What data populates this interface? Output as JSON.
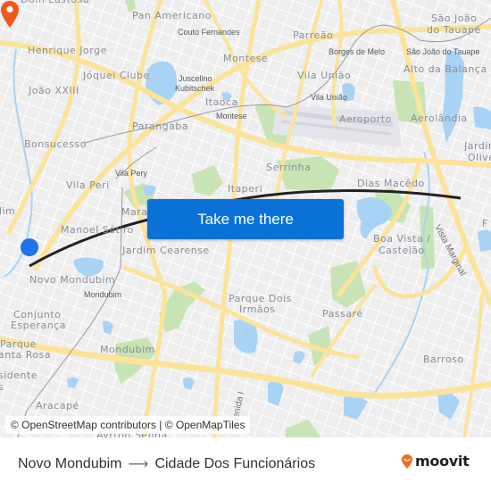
{
  "map": {
    "neighborhoods": [
      {
        "name": "Dom Lustosa"
      },
      {
        "name": "Pan Americano"
      },
      {
        "name": "Henrique Jorge"
      },
      {
        "name": "Jóquei Clube"
      },
      {
        "name": "João XXIII"
      },
      {
        "name": "Montese"
      },
      {
        "name": "Parreão"
      },
      {
        "name": "Vila União"
      },
      {
        "name": "São João do Tauape"
      },
      {
        "name": "Alto da Balança"
      },
      {
        "name": "Aeroporto"
      },
      {
        "name": "Aerolândia"
      },
      {
        "name": "Itaoca"
      },
      {
        "name": "Parangaba"
      },
      {
        "name": "Bonsucesso"
      },
      {
        "name": "Serrinha"
      },
      {
        "name": "Jardim Oliveiras"
      },
      {
        "name": "Vila Peri"
      },
      {
        "name": "Itaperi"
      },
      {
        "name": "Dias Macêdo"
      },
      {
        "name": "Maraponga"
      },
      {
        "name": "Manoel Sátiro"
      },
      {
        "name": "Jardim Cearense"
      },
      {
        "name": "Boa Vista / Castelão"
      },
      {
        "name": "Novo Mondubim"
      },
      {
        "name": "Conjunto Esperança"
      },
      {
        "name": "Parque Dois Irmãos"
      },
      {
        "name": "Passaré"
      },
      {
        "name": "Parque Santa Rosa"
      },
      {
        "name": "Mondubim"
      },
      {
        "name": "Barroso"
      },
      {
        "name": "Presidente Vargas"
      },
      {
        "name": "Aracapé"
      },
      {
        "name": "Ayrton Senna"
      }
    ],
    "labels": {
      "dom_lustosa": "Dom Lustosa",
      "pan_americano": "Pan Americano",
      "couto_fernandes": "Couto Fernandes",
      "henrique_jorge": "Henrique Jorge",
      "joquei_clube": "Jóquei Clube",
      "juscelino_1": "Juscelino",
      "juscelino_2": "Kubitschek",
      "joao_xxiii": "João XXIII",
      "montese": "Montese",
      "montese_station": "Montese",
      "parreao": "Parreão",
      "borges_de_melo": "Borges de Melo",
      "vila_uniao": "Vila União",
      "vila_uniao_station": "Vila União",
      "sao_joao_1": "São João",
      "sao_joao_2": "do Tauape",
      "sao_joao_station": "São João do Tauape",
      "alto_da_balanca": "Alto da Balança",
      "itaoca": "Itaoca",
      "aeroporto": "Aeroporto",
      "aerolandia": "Aerolândia",
      "parangaba": "Parangaba",
      "bonsucesso": "Bonsucesso",
      "serrinha": "Serrinha",
      "jardim_oliveiras_1": "Jardim",
      "jardim_oliveiras_2": "Olive",
      "vila_pery_station": "Vila Pery",
      "vila_peri": "Vila Peri",
      "itaperi": "Itaperi",
      "dias_macedo": "Dias Macêdo",
      "dim": "dim",
      "maraponga": "Marap",
      "manoel_satiro": "Manoel Sátiro",
      "jardim_cearense": "Jardim Cearense",
      "boa_vista_1": "Boa Vista /",
      "boa_vista_2": "Castelão",
      "vista_marginal": "Vista Marginal",
      "novo_mondubim": "Novo Mondubim",
      "mondubim_station": "Mondubim",
      "conjunto_1": "Conjunto",
      "conjunto_2": "Esperança",
      "parque_dois_1": "Parque Dois",
      "parque_dois_2": "Irmãos",
      "passare": "Passaré",
      "parque_sr_1": "Parque",
      "parque_sr_2": "anta Rosa",
      "mondubim": "Mondubim",
      "barroso": "Barroso",
      "presidente_1": "sidente",
      "presidente_2": "s",
      "aracape": "Aracapé",
      "avenida_i": "venida I",
      "ayrton_senna": "Ayrton Senna",
      "f_edge": "F"
    },
    "cta_button": "Take me there",
    "attribution": {
      "osm": "© OpenStreetMap contributors",
      "separator": " | ",
      "omt": "© OpenMapTiles"
    },
    "colors": {
      "route_line": "#222222",
      "origin_marker": "#1e73e8",
      "destination_marker": "#ef5a1c",
      "cta_background": "#0a72d6",
      "water": "#a9d3f5",
      "park": "#c8e3b0",
      "major_road": "#fbe49a"
    }
  },
  "footer": {
    "origin": "Novo Mondubim",
    "arrow": "⟶",
    "destination": "Cidade Dos Funcionários",
    "brand": "moovit",
    "brand_color": "#f26b21"
  }
}
